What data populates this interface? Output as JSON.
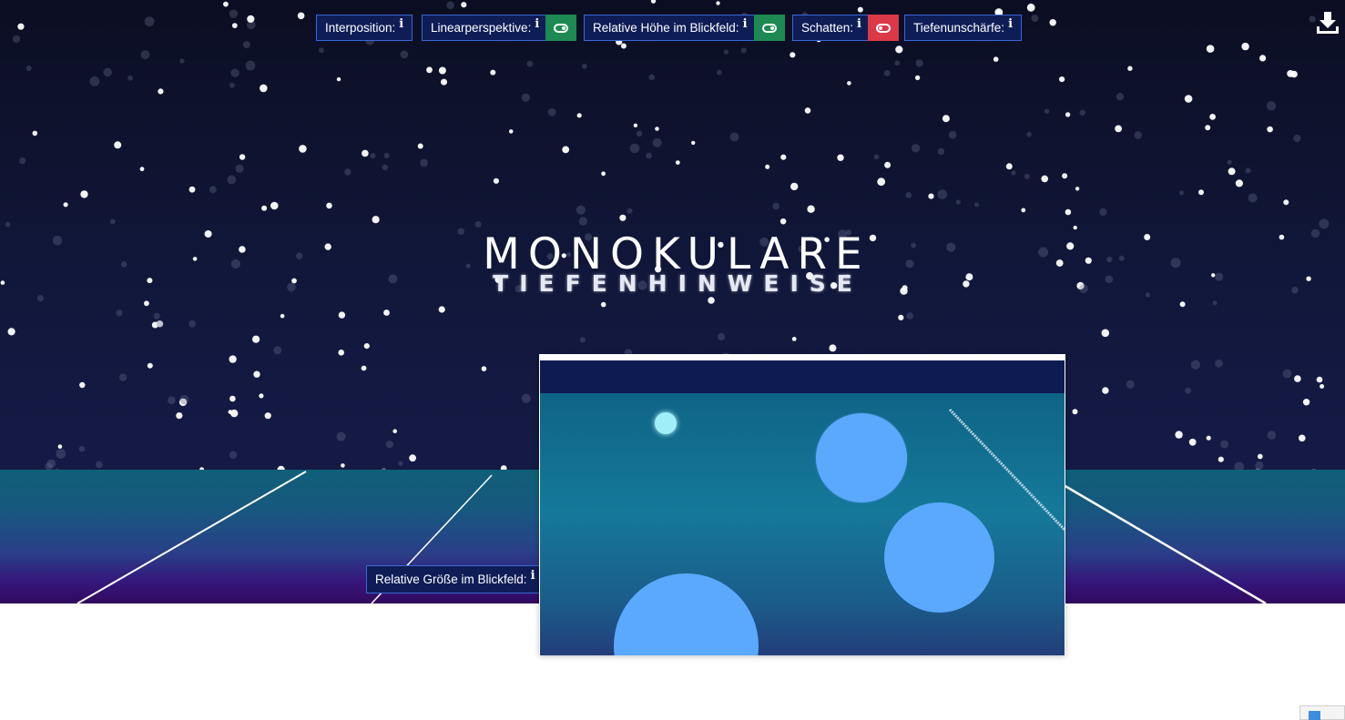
{
  "toolbar": {
    "controls": [
      {
        "label": "Interposition:",
        "info": "i",
        "toggle": null
      },
      {
        "label": "Linearperspektive:",
        "info": "i",
        "toggle": "on"
      },
      {
        "label": "Relative Höhe im Blickfeld:",
        "info": "i",
        "toggle": "on"
      },
      {
        "label": "Schatten:",
        "info": "i",
        "toggle": "off"
      },
      {
        "label": "Tiefenunschärfe:",
        "info": "i",
        "toggle": null
      }
    ],
    "download_icon": "download-icon"
  },
  "heading": {
    "title": "MONOKULARE",
    "subtitle": "TIEFENHINWEISE"
  },
  "relative_size": {
    "label": "Relative Größe im Blickfeld:",
    "info": "i"
  },
  "colors": {
    "toggle_on": "#1c8a52",
    "toggle_off": "#db3848",
    "control_bg": "#0f1d57",
    "control_border": "#3a67d6",
    "ball": "#5aa9ff"
  }
}
